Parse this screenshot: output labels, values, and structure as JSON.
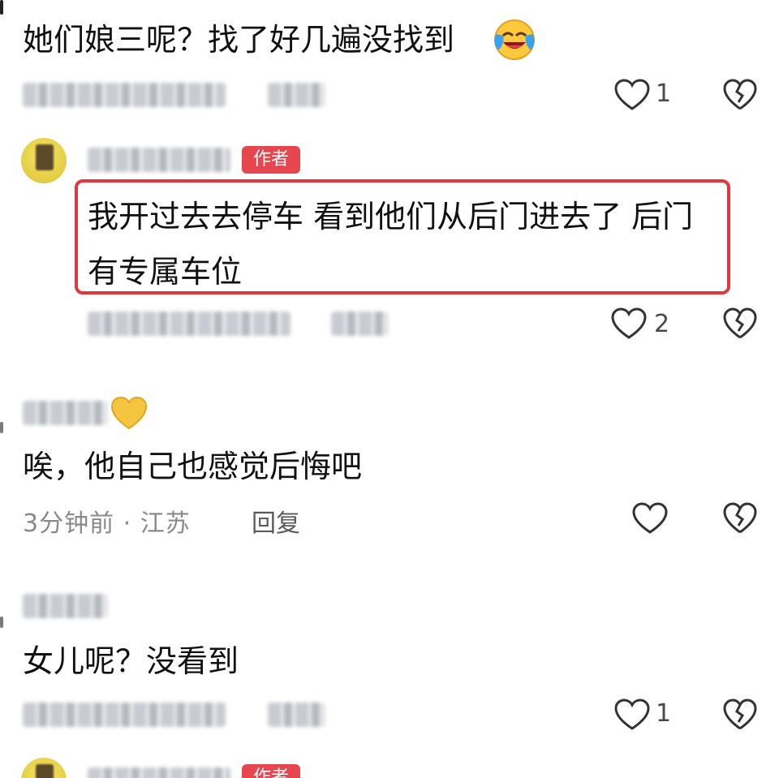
{
  "comments": [
    {
      "text": "她们娘三呢？找了好几遍没找到",
      "emoji": "crying-laughing-face-icon",
      "likes": "1"
    },
    {
      "badge": "作者",
      "text_line1": "我开过去去停车 看到他们从后门进去了 后门",
      "text_line2": "有专属车位",
      "likes": "2"
    },
    {
      "text": "唉，他自己也感觉后悔吧",
      "meta": "3分钟前 · 江苏",
      "reply": "回复",
      "likes": ""
    },
    {
      "text": "女儿呢？没看到",
      "likes": "1"
    },
    {
      "badge": "作者"
    }
  ],
  "colors": {
    "badge": "#e8464f",
    "highlight": "#e2363f",
    "meta": "#8a8a8a"
  }
}
